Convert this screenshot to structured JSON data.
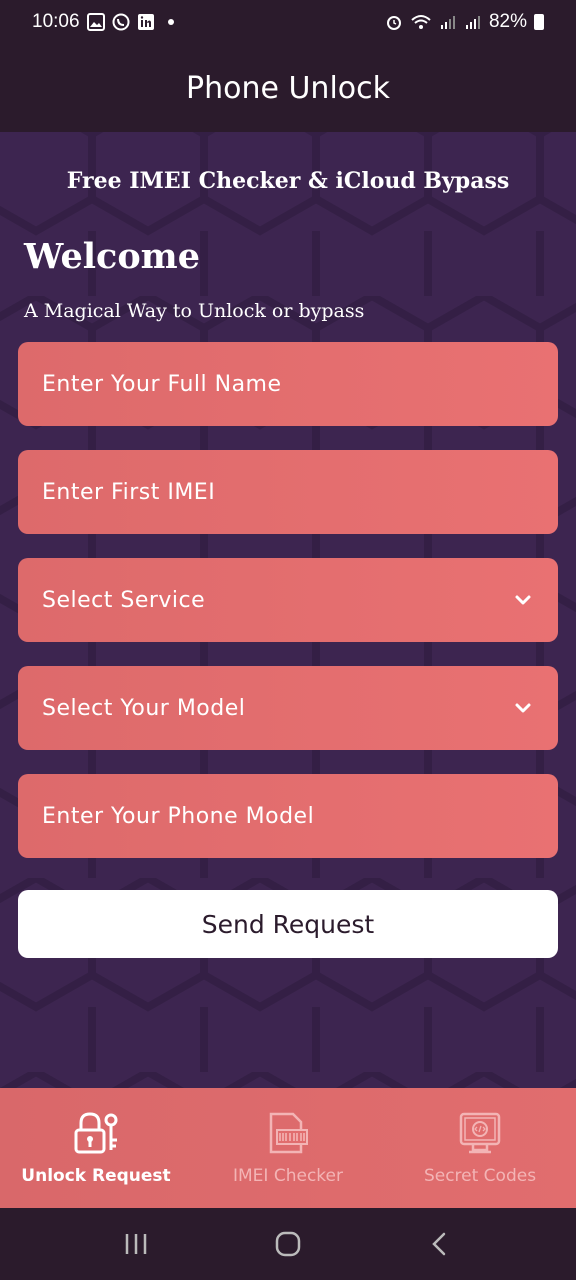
{
  "status_bar": {
    "time": "10:06",
    "battery": "82%",
    "icons": [
      "gallery-icon",
      "whatsapp-icon",
      "linkedin-icon",
      "alarm-icon",
      "wifi-icon",
      "signal-icon",
      "battery-icon"
    ]
  },
  "app_bar": {
    "title": "Phone Unlock"
  },
  "main": {
    "subtitle": "Free IMEI Checker & iCloud Bypass",
    "welcome": "Welcome",
    "tagline": "A Magical Way to Unlock or bypass",
    "fields": {
      "full_name": "Enter Your Full Name",
      "first_imei": "Enter First IMEI",
      "service": "Select Service",
      "model_select": "Select Your Model",
      "phone_model": "Enter Your Phone Model"
    },
    "send_label": "Send Request"
  },
  "bottom_nav": {
    "items": [
      {
        "label": "Unlock Request",
        "icon": "lock-key-icon",
        "active": true
      },
      {
        "label": "IMEI Checker",
        "icon": "imei-barcode-icon",
        "active": false
      },
      {
        "label": "Secret Codes",
        "icon": "code-monitor-icon",
        "active": false
      }
    ]
  },
  "colors": {
    "field_bg": "#e16d6e",
    "main_bg": "#3d2550",
    "bar_bg": "#2b1b2c",
    "inactive_label": "#f3b4b5"
  }
}
